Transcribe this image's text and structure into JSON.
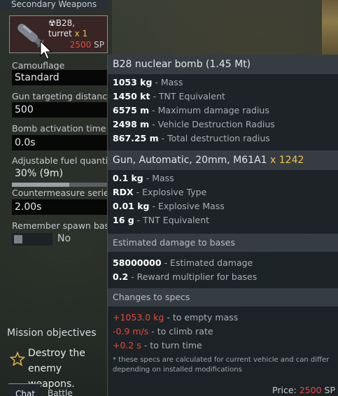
{
  "panel": {
    "section_title": "Secondary Weapons",
    "weapon": {
      "name": "B28,",
      "name_line2": "turret",
      "qty": "x 1",
      "cost_value": "2500",
      "cost_unit": "SP",
      "icon": "nuclear-symbol"
    },
    "fields": [
      {
        "label": "Camouflage",
        "value": "Standard"
      },
      {
        "label": "Gun targeting distance",
        "value": "500"
      },
      {
        "label": "Bomb activation time",
        "value": "0.0s"
      },
      {
        "label": "Adjustable fuel quantity",
        "value": "30% (9m)"
      },
      {
        "label": "Countermeasure series",
        "value": "2.00s"
      },
      {
        "label": "Remember spawn base",
        "value": "No"
      }
    ],
    "fuel_slider_fraction": 0.6,
    "mission_title": "Mission objectives",
    "mission_item": "Destroy the enemy weapons.",
    "tabs": [
      "Chat",
      "Battle"
    ]
  },
  "tooltip": {
    "bomb": {
      "title": "B28 nuclear bomb (1.45 Mt)",
      "rows": [
        {
          "value": "1053 kg",
          "desc": " - Mass"
        },
        {
          "value": "1450 kt",
          "desc": " - TNT Equivalent"
        },
        {
          "value": "6575 m",
          "desc": " - Maximum damage radius"
        },
        {
          "value": "2498 m",
          "desc": " - Vehicle Destruction Radius"
        },
        {
          "value": "867.25 m",
          "desc": " - Total destruction radius"
        }
      ]
    },
    "gun": {
      "title": "Gun, Automatic, 20mm, M61A1",
      "qty": "x 1242",
      "rows": [
        {
          "value": "0.1 kg",
          "desc": " - Mass"
        },
        {
          "value": "RDX",
          "desc": " - Explosive Type"
        },
        {
          "value": "0.01 kg",
          "desc": " - Explosive Mass"
        },
        {
          "value": "16 g",
          "desc": " - TNT Equivalent"
        }
      ]
    },
    "bases": {
      "title": "Estimated damage to bases",
      "rows": [
        {
          "value": "58000000",
          "desc": " - Estimated damage"
        },
        {
          "value": "0.2",
          "desc": " - Reward multiplier for bases"
        }
      ]
    },
    "changes": {
      "title": "Changes to specs",
      "rows": [
        {
          "value": "+1053.0 kg",
          "desc": " - to empty mass"
        },
        {
          "value": "-0.9 m/s",
          "desc": " - to climb rate"
        },
        {
          "value": "+0.2 s",
          "desc": " - to turn time"
        }
      ],
      "note": "* these specs are calculated for current vehicle and can differ depending on installed modifications"
    },
    "price_label": "Price:",
    "price_value": "2500",
    "price_unit": "SP"
  },
  "colors": {
    "accent_yellow": "#f0c24a",
    "cost_red": "#e84a3c"
  }
}
